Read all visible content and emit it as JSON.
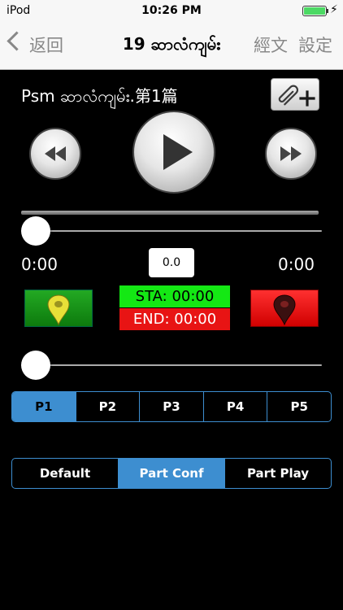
{
  "status_bar": {
    "carrier": "iPod",
    "time": "10:26 PM",
    "battery_icon": "battery-icon",
    "charging_icon": "lightning-icon",
    "battery_level": 1.0
  },
  "nav": {
    "back_label": "返回",
    "title": "19 ဆာလံကျမ်း",
    "scripture_label": "經文",
    "settings_label": "設定"
  },
  "track": {
    "title": "Psm ဆာလံကျမ်း.第1篇",
    "attach_icon": "paperclip-add-icon"
  },
  "transport": {
    "rewind_icon": "rewind-icon",
    "play_icon": "play-icon",
    "fast_forward_icon": "fast-forward-icon"
  },
  "progress": {
    "position_fraction": 0.0,
    "current_time": "0:00",
    "total_time": "0:00",
    "speed_value": "0.0"
  },
  "markers": {
    "start_icon": "map-pin-green-icon",
    "end_icon": "map-pin-red-icon",
    "start_label": "STA: 00:00",
    "end_label": "END: 00:00"
  },
  "volume": {
    "level_fraction": 0.0
  },
  "parts": {
    "items": [
      "P1",
      "P2",
      "P3",
      "P4",
      "P5"
    ],
    "selected": "P1"
  },
  "modes": {
    "items": [
      "Default",
      "Part Conf",
      "Part Play"
    ],
    "selected": "Part Conf"
  },
  "colors": {
    "accent": "#3d8ed0",
    "start_marker": "#14e814",
    "end_marker": "#e81414"
  }
}
